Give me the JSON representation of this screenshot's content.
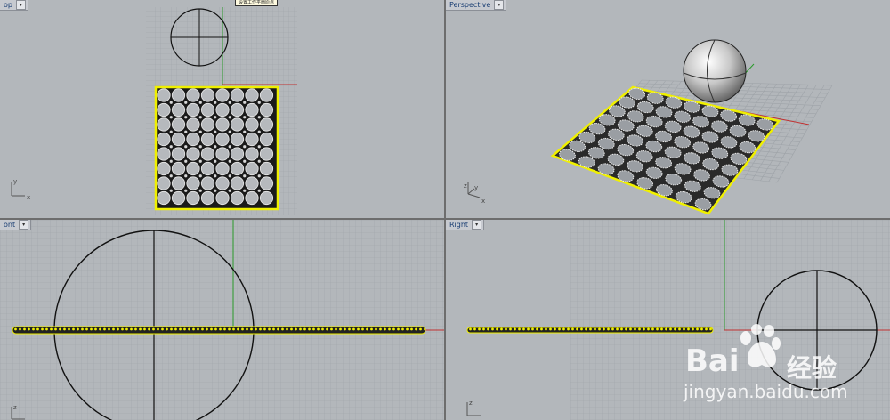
{
  "viewports": {
    "top": {
      "label": "op",
      "tooltip": "设置工作平面原点"
    },
    "perspective": {
      "label": "Perspective"
    },
    "front": {
      "label": "ont"
    },
    "right": {
      "label": "Right"
    }
  },
  "axes": {
    "x": "x",
    "y": "y",
    "z": "z"
  },
  "watermark": {
    "brand": "Bai",
    "brand_cn": "经验",
    "url": "jingyan.baidu.com"
  },
  "colors": {
    "viewport_bg": "#b3b7bb",
    "grid": "#9ea3a8",
    "selection": "#f0f000",
    "x_axis": "#c03030",
    "y_axis": "#2a9a2a"
  }
}
